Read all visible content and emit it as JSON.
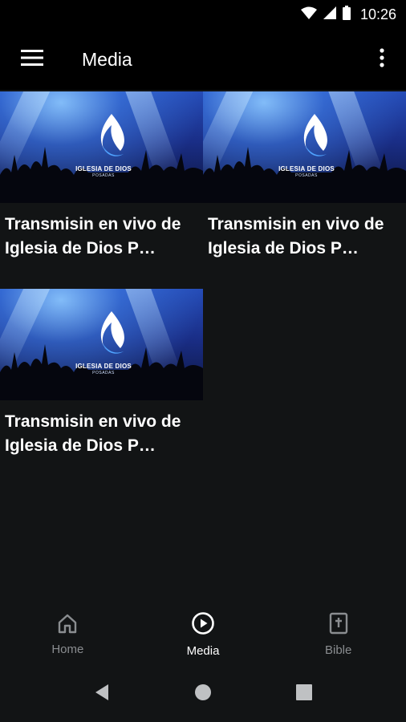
{
  "status": {
    "time": "10:26"
  },
  "app_bar": {
    "title": "Media"
  },
  "media": {
    "items": [
      {
        "title": "Transmisin en vivo de Iglesia de Dios P…",
        "logo_text": "IGLESIA DE DIOS",
        "logo_sub": "POSADAS"
      },
      {
        "title": "Transmisin en vivo de Iglesia de Dios P…",
        "logo_text": "IGLESIA DE DIOS",
        "logo_sub": "POSADAS"
      },
      {
        "title": "Transmisin en vivo de Iglesia de Dios P…",
        "logo_text": "IGLESIA DE DIOS",
        "logo_sub": "POSADAS"
      }
    ]
  },
  "bottom_nav": {
    "items": [
      {
        "label": "Home",
        "icon": "home-icon",
        "active": false
      },
      {
        "label": "Media",
        "icon": "play-circle-icon",
        "active": true
      },
      {
        "label": "Bible",
        "icon": "bible-icon",
        "active": false
      }
    ]
  },
  "colors": {
    "background": "#121415",
    "bar": "#000000",
    "inactive": "#8a8d90",
    "active": "#ffffff"
  }
}
